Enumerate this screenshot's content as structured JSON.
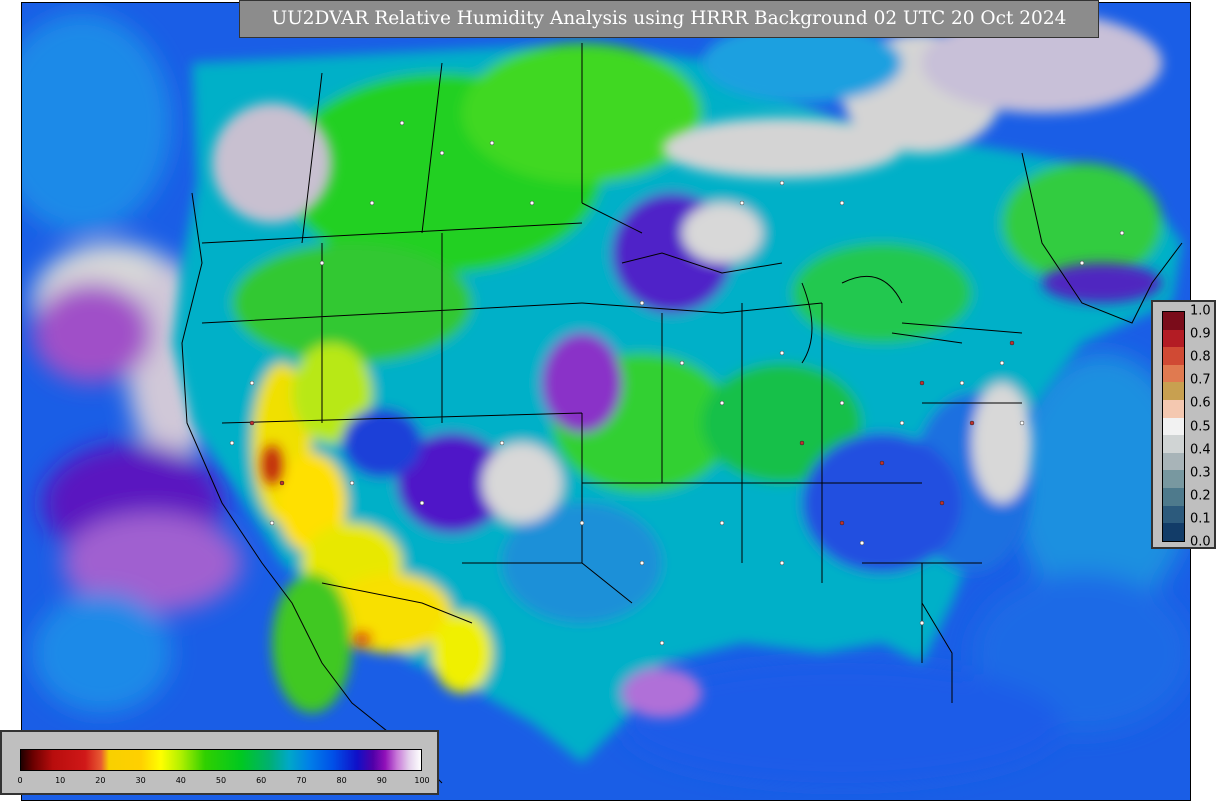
{
  "title": "UU2DVAR Relative Humidity Analysis using HRRR Background 02 UTC 20 Oct 2024",
  "humidity_colorbar": {
    "ticks": [
      "0",
      "10",
      "20",
      "30",
      "40",
      "50",
      "60",
      "70",
      "80",
      "90",
      "100"
    ]
  },
  "ratio_colorbar": {
    "ticks": [
      "1.0",
      "0.9",
      "0.8",
      "0.7",
      "0.6",
      "0.5",
      "0.4",
      "0.3",
      "0.2",
      "0.1",
      "0.0"
    ],
    "colors": [
      "#7a0c1a",
      "#b31c24",
      "#d04a34",
      "#e07a50",
      "#c8a050",
      "#f4c8b0",
      "#f2f2f2",
      "#d0d4d4",
      "#a8b4b8",
      "#7898a0",
      "#4e7a8c",
      "#2c5a7c",
      "#123c68"
    ]
  }
}
